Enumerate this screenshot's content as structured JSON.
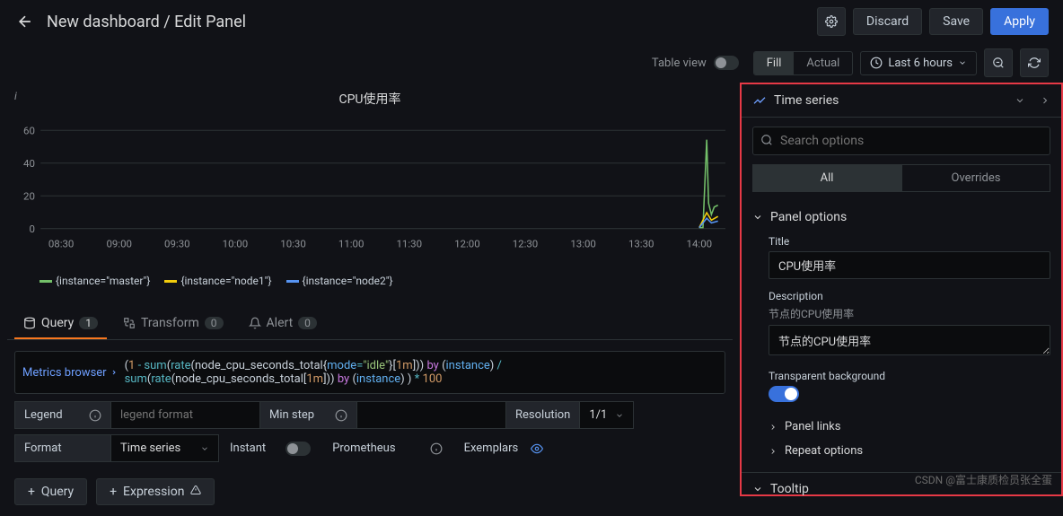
{
  "header": {
    "title": "New dashboard / Edit Panel",
    "discard": "Discard",
    "save": "Save",
    "apply": "Apply"
  },
  "toolbar": {
    "table_view": "Table view",
    "fill": "Fill",
    "actual": "Actual",
    "time_range": "Last 6 hours"
  },
  "chart_data": {
    "type": "line",
    "title": "CPU使用率",
    "xlabel": "",
    "ylabel": "",
    "ylim": [
      0,
      60
    ],
    "xticks": [
      "08:30",
      "09:00",
      "09:30",
      "10:00",
      "10:30",
      "11:00",
      "11:30",
      "12:00",
      "12:30",
      "13:00",
      "13:30",
      "14:00"
    ],
    "series": [
      {
        "name": "{instance=\"master\"}",
        "color": "#73bf69",
        "values_note": "flat near 1 until 14:00 then spike to ~55 then drop to ~15",
        "sample": [
          1,
          1,
          1,
          1,
          1,
          1,
          1,
          1,
          1,
          1,
          1,
          55,
          15
        ]
      },
      {
        "name": "{instance=\"node1\"}",
        "color": "#f2cc0c",
        "values_note": "flat near 1 until 14:00 then small spike ~10",
        "sample": [
          1,
          1,
          1,
          1,
          1,
          1,
          1,
          1,
          1,
          1,
          1,
          10,
          8
        ]
      },
      {
        "name": "{instance=\"node2\"}",
        "color": "#5794f2",
        "values_note": "flat near 1 then small spike",
        "sample": [
          1,
          1,
          1,
          1,
          1,
          1,
          1,
          1,
          1,
          1,
          1,
          8,
          6
        ]
      }
    ]
  },
  "tabs": {
    "query": "Query",
    "query_count": "1",
    "transform": "Transform",
    "transform_count": "0",
    "alert": "Alert",
    "alert_count": "0"
  },
  "query": {
    "metrics_browser": "Metrics browser",
    "expression": "(1 - sum(rate(node_cpu_seconds_total{mode=\"idle\"}[1m])) by (instance) / sum(rate(node_cpu_seconds_total[1m])) by (instance) ) * 100",
    "legend_label": "Legend",
    "legend_placeholder": "legend format",
    "min_step_label": "Min step",
    "resolution_label": "Resolution",
    "resolution_value": "1/1",
    "format_label": "Format",
    "format_value": "Time series",
    "instant_label": "Instant",
    "prometheus_label": "Prometheus",
    "exemplars_label": "Exemplars"
  },
  "add": {
    "query": "Query",
    "expression": "Expression"
  },
  "right": {
    "viz_type": "Time series",
    "search_placeholder": "Search options",
    "all": "All",
    "overrides": "Overrides",
    "panel_options": "Panel options",
    "title_label": "Title",
    "title_value": "CPU使用率",
    "desc_label": "Description",
    "desc_sub": "节点的CPU使用率",
    "desc_value": "节点的CPU使用率",
    "transparent_label": "Transparent background",
    "panel_links": "Panel links",
    "repeat_options": "Repeat options",
    "tooltip": "Tooltip"
  },
  "watermark": "CSDN @富士康质检员张全蛋"
}
